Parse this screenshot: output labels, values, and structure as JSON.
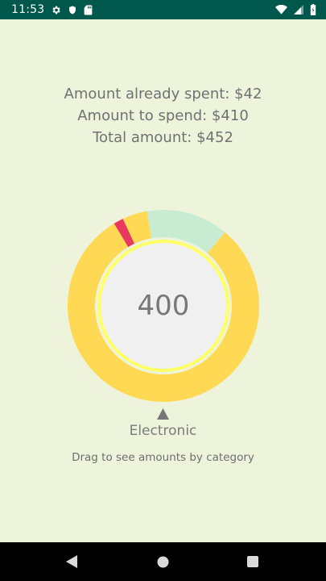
{
  "status_bar": {
    "time": "11:53",
    "icons_left": [
      "gear-icon",
      "shield-icon",
      "sd-card-icon"
    ],
    "icons_right": [
      "wifi-icon",
      "cell-signal-icon",
      "battery-icon"
    ],
    "background": "#00574b"
  },
  "summary": {
    "spent": "Amount already spent: $42",
    "to_spend": "Amount to spend: $410",
    "total": "Total amount: $452"
  },
  "chart_data": {
    "type": "pie",
    "segments": [
      {
        "value_degrees": 50,
        "start_degrees": -10,
        "color": "#c8ecd2"
      },
      {
        "value_degrees": 289,
        "start_degrees": 40,
        "color": "#ffd953"
      },
      {
        "value_degrees": 6,
        "start_degrees": 329,
        "color": "#e8395e"
      },
      {
        "value_degrees": 15,
        "start_degrees": 335,
        "color": "#ffd953"
      }
    ],
    "inner_ring_color": "#ffff66",
    "center_color": "#f0f0f0",
    "center_value": "400"
  },
  "selected_category": "Electronic",
  "hint": "Drag to see amounts by category",
  "nav": {
    "buttons": [
      "back-icon",
      "home-icon",
      "recents-icon"
    ]
  },
  "colors": {
    "background": "#eef4db",
    "text": "#717171"
  }
}
